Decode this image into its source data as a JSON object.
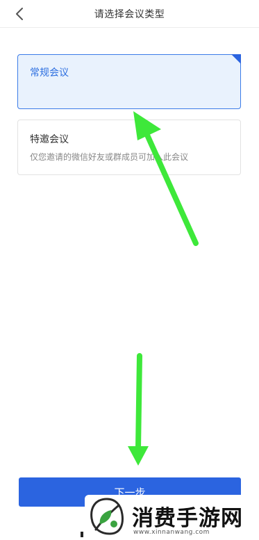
{
  "header": {
    "title": "请选择会议类型",
    "back_icon": "chevron-left-icon"
  },
  "options": [
    {
      "title": "常规会议",
      "selected": true
    },
    {
      "title": "特邀会议",
      "description": "仅您邀请的微信好友或群成员可加入此会议",
      "selected": false
    }
  ],
  "next_button": {
    "label": "下一步"
  },
  "watermark": {
    "name": "消费手游网",
    "url": "www.xinnanwang.com"
  },
  "colors": {
    "accent": "#2b64e0",
    "selected_bg": "#e9f2fd",
    "selected_border": "#3b7be8",
    "annotation_arrow": "#3ee83a"
  }
}
